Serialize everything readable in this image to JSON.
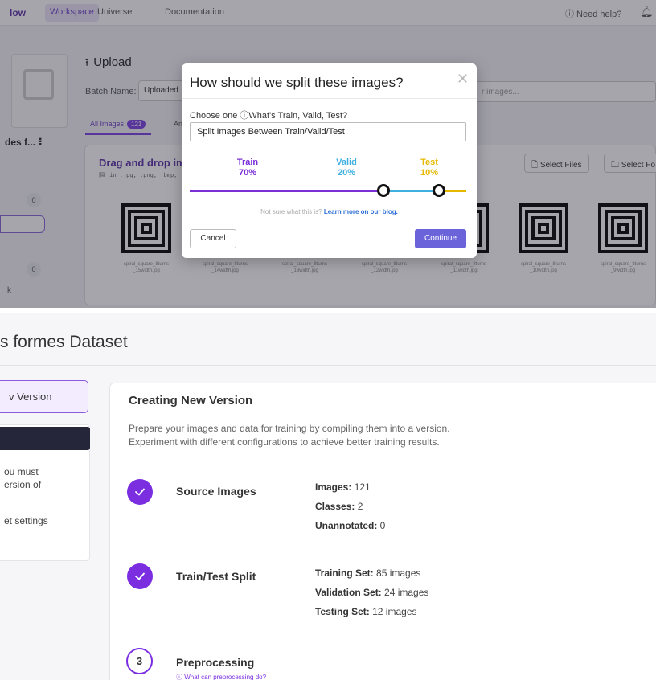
{
  "top": {
    "nav": {
      "logo": "low",
      "workspace": "Workspace",
      "universe": "Universe",
      "documentation": "Documentation",
      "help": "ⓘ Need help?"
    },
    "sidebar": {
      "dataset_label": "des f... ⠇",
      "count_a": "0",
      "count_b": "0",
      "k_label": "k"
    },
    "upload": {
      "title": "Upload",
      "batch_label": "Batch Name:",
      "batch_value": "Uploaded",
      "tab_all": "All Images",
      "tab_all_count": "121",
      "tab_an": "An",
      "search_placeholder": "r images..."
    },
    "drop": {
      "title": "Drag and drop im",
      "formats": "in .jpg, .png, .bmp, .",
      "select_files": "Select Files",
      "select_folder": "Select Fo"
    },
    "thumbs": [
      {
        "caption": "spiral_square_8turns _15width.jpg"
      },
      {
        "caption": "spiral_square_8turns _14width.jpg"
      },
      {
        "caption": "spiral_square_8turns _13width.jpg"
      },
      {
        "caption": "spiral_square_8turns _12width.jpg"
      },
      {
        "caption": "spiral_square_8turns _11width.jpg"
      },
      {
        "caption": "spiral_square_8turns _10width.jpg"
      },
      {
        "caption": "spiral_square_8turns _9width.jpg"
      }
    ],
    "modal": {
      "title": "How should we split these images?",
      "close": "✕",
      "choose": "Choose one ⓘWhat's Train, Valid, Test?",
      "select_value": "Split Images Between Train/Valid/Test",
      "train_label": "Train",
      "train_pct": "70%",
      "valid_label": "Valid",
      "valid_pct": "20%",
      "test_label": "Test",
      "test_pct": "10%",
      "learn_prefix": "Not sure what this is?",
      "learn_link": "Learn more on our blog.",
      "cancel": "Cancel",
      "continue": "Continue",
      "colors": {
        "train": "#7b2fd6",
        "valid": "#3fb0e0",
        "test": "#e6b800"
      }
    }
  },
  "bottom": {
    "title": "s formes Dataset",
    "version_button": "v Version",
    "side_lines": [
      "ou must",
      "ersion of",
      "et settings"
    ],
    "heading": "Creating New Version",
    "desc1": "Prepare your images and data for training by compiling them into a version.",
    "desc2": "Experiment with different configurations to achieve better training results.",
    "step1": {
      "name": "Source Images",
      "images_k": "Images:",
      "images_v": "121",
      "classes_k": "Classes:",
      "classes_v": "2",
      "unannotated_k": "Unannotated:",
      "unannotated_v": "0"
    },
    "step2": {
      "name": "Train/Test Split",
      "training_k": "Training Set:",
      "training_v": "85 images",
      "validation_k": "Validation Set:",
      "validation_v": "24 images",
      "testing_k": "Testing Set:",
      "testing_v": "12 images"
    },
    "step3": {
      "number": "3",
      "name": "Preprocessing",
      "link": "ⓘ What can preprocessing do?"
    }
  }
}
